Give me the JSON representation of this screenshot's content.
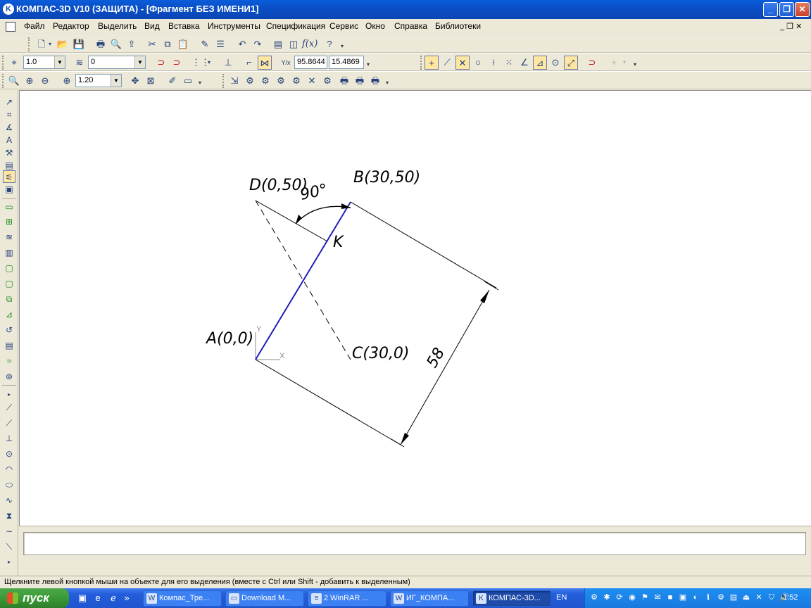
{
  "window": {
    "title": "КОМПАС-3D V10 (ЗАЩИТА) - [Фрагмент БЕЗ ИМЕНИ1]",
    "minimize": "_",
    "maximize": "❐",
    "close": "✕"
  },
  "menu": {
    "items": [
      "Файл",
      "Редактор",
      "Выделить",
      "Вид",
      "Вставка",
      "Инструменты",
      "Спецификация",
      "Сервис",
      "Окно",
      "Справка",
      "Библиотеки"
    ],
    "doc_controls": "_ ❐ ✕"
  },
  "toolbar_current": {
    "step": "1.0",
    "layer": "0",
    "x_coord": "95.8644",
    "y_coord": "15.4869"
  },
  "toolbar_view": {
    "zoom": "1.20"
  },
  "drawing": {
    "labels": {
      "D": "D(0,50)",
      "B": "B(30,50)",
      "A": "A(0,0)",
      "C": "C(30,0)",
      "K": "K",
      "angle": "90°",
      "dimension": "58",
      "axis_x": "X",
      "axis_y": "Y"
    },
    "colors": {
      "segment_AB": "#1f1fb8",
      "line": "#000000",
      "axis": "#8a8a8a"
    }
  },
  "status": {
    "hint": "Щелкните левой кнопкой мыши на объекте для его выделения (вместе с Ctrl или Shift - добавить к выделенным)"
  },
  "taskbar": {
    "start": "пуск",
    "quicklaunch_more": "»",
    "tasks": [
      {
        "label": "Компас_Тре...",
        "icon": "word-doc-icon"
      },
      {
        "label": "Download M...",
        "icon": "folder-icon"
      },
      {
        "label": "2 WinRAR ...",
        "icon": "winrar-icon"
      },
      {
        "label": "ИГ_КОМПА...",
        "icon": "document-icon"
      },
      {
        "label": "КОМПАС-3D...",
        "icon": "kompas-icon"
      }
    ],
    "language": "EN",
    "clock": "1:52"
  }
}
